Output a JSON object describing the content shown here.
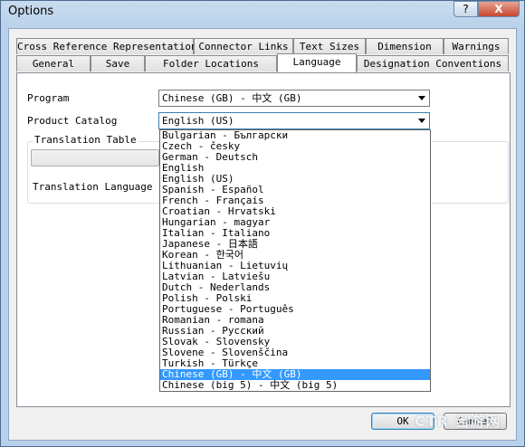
{
  "window": {
    "title": "Options",
    "help_label": "?",
    "close_label": "X"
  },
  "tabs": {
    "row_top": [
      "Cross Reference Representation",
      "Connector Links",
      "Text Sizes",
      "Dimension",
      "Warnings"
    ],
    "row_bottom": [
      "General",
      "Save",
      "Folder Locations",
      "Language",
      "Designation Conventions"
    ],
    "active": "Language"
  },
  "language_tab": {
    "program_label": "Program",
    "program_value": "Chinese (GB) - 中文 (GB)",
    "catalog_label": "Product Catalog",
    "catalog_value": "English (US)",
    "translation_table_label": "Translation Table",
    "translation_language_label": "Translation Language"
  },
  "dropdown": {
    "options": [
      "Bulgarian - Български",
      "Czech - česky",
      "German - Deutsch",
      "English",
      "English (US)",
      "Spanish - Español",
      "French - Français",
      "Croatian - Hrvatski",
      "Hungarian - magyar",
      "Italian - Italiano",
      "Japanese - 日本語",
      "Korean - 한국어",
      "Lithuanian - Lietuvių",
      "Latvian - Latviešu",
      "Dutch - Nederlands",
      "Polish - Polski",
      "Portuguese - Português",
      "Romanian - romana",
      "Russian - Русский",
      "Slovak - Slovensky",
      "Slovene - Slovenščina",
      "Turkish - Türkçe",
      "Chinese (GB) - 中文 (GB)",
      "Chinese (big 5) - 中文 (big 5)"
    ],
    "highlighted": "Chinese (GB) - 中文 (GB)"
  },
  "buttons": {
    "ok": "OK",
    "cancel": "Cancel"
  },
  "watermark": "CTR 当游网",
  "colors": {
    "selection": "#3399ff",
    "focus_border": "#3c7fb1"
  }
}
